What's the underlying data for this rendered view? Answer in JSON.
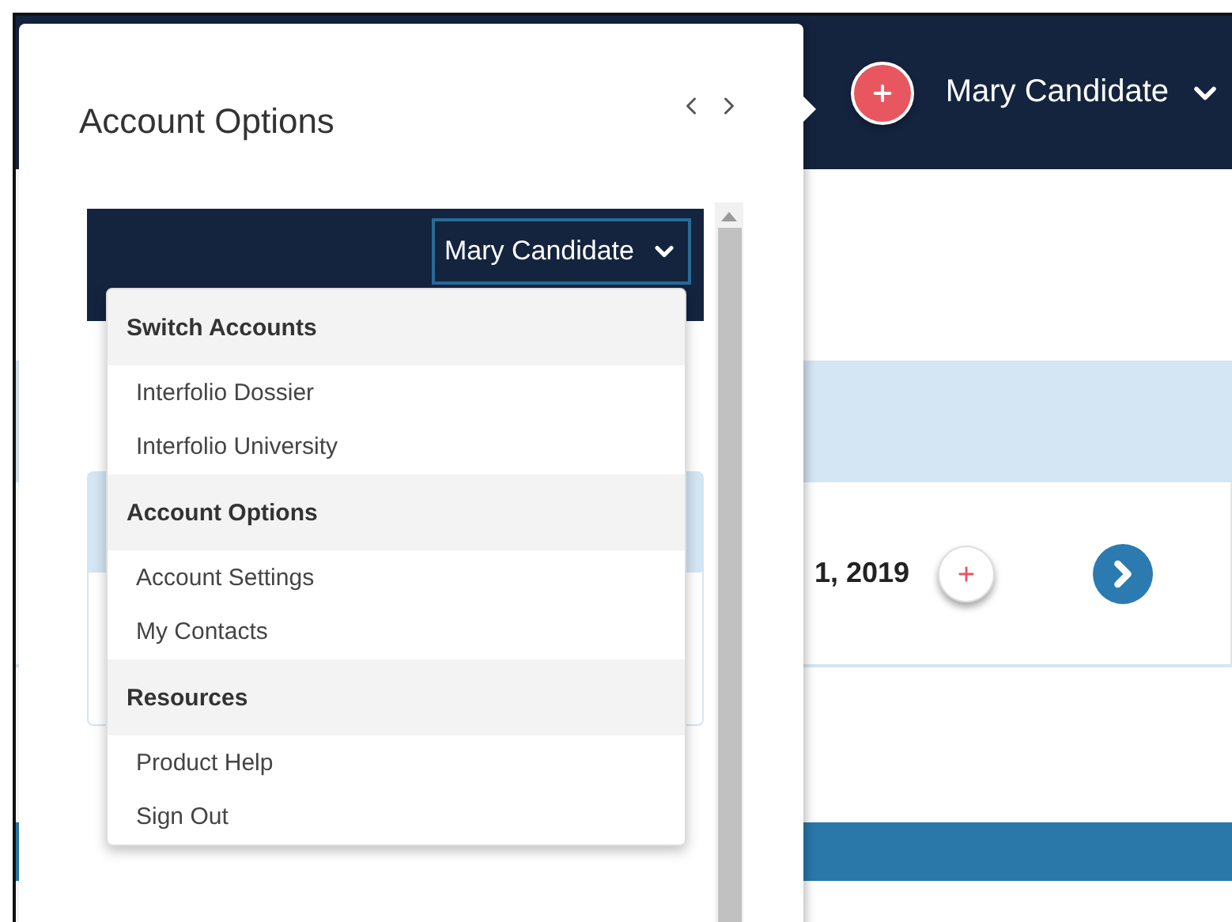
{
  "header": {
    "user": "Mary Candidate"
  },
  "card": {
    "date": "1, 2019"
  },
  "popover": {
    "title": "Account Options"
  },
  "preview": {
    "user": "Mary Candidate"
  },
  "menu": {
    "sections": [
      {
        "title": "Switch Accounts",
        "items": [
          "Interfolio Dossier",
          "Interfolio University"
        ]
      },
      {
        "title": "Account Options",
        "items": [
          "Account Settings",
          "My Contacts"
        ]
      },
      {
        "title": "Resources",
        "items": [
          "Product Help",
          "Sign Out"
        ]
      }
    ]
  }
}
